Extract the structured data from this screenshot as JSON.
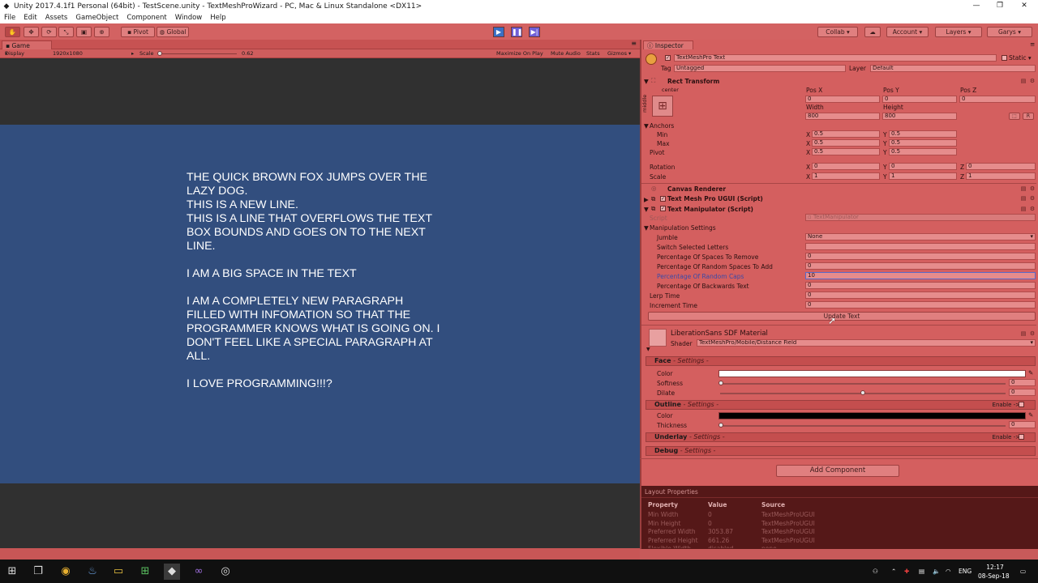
{
  "titlebar": {
    "title": "Unity 2017.4.1f1 Personal (64bit) - TestScene.unity - TextMeshProWizard - PC, Mac & Linux Standalone <DX11>",
    "minimize": "—",
    "maximize": "❐",
    "close": "✕"
  },
  "menu": [
    "File",
    "Edit",
    "Assets",
    "GameObject",
    "Component",
    "Window",
    "Help"
  ],
  "toolbar": {
    "pivot": "Pivot",
    "global": "Global",
    "collab": "Collab ▾",
    "account": "Account ▾",
    "layers": "Layers ▾",
    "layout": "Garys ▾"
  },
  "game": {
    "tab": "Game",
    "display": "Display 1",
    "resolution": "1920x1080",
    "scale_label": "Scale",
    "scale_value": "0.62",
    "maximize_on_play": "Maximize On Play",
    "mute_audio": "Mute Audio",
    "stats": "Stats",
    "gizmos": "Gizmos ▾",
    "text": "THE QUICK BROWN FOX JUMPS OVER THE\nLAZY DOG.\nTHIS IS A NEW LINE.\nTHIS IS A LINE THAT OVERFLOWS THE TEXT\nBOX BOUNDS AND GOES ON TO THE NEXT\nLINE.\n\nI AM A BIG SPACE IN THE TEXT\n\nI AM A COMPLETELY NEW PARAGRAPH\nFILLED WITH INFOMATION SO THAT THE\nPROGRAMMER KNOWS WHAT IS GOING ON. I\nDON'T FEEL LIKE A SPECIAL PARAGRAPH AT\nALL.\n\nI LOVE PROGRAMMING!!!?"
  },
  "inspector": {
    "tab": "Inspector",
    "object_name": "TextMeshPro Text",
    "static_label": "Static",
    "tag_label": "Tag",
    "tag_value": "Untagged",
    "layer_label": "Layer",
    "layer_value": "Default",
    "rect_transform": {
      "title": "Rect Transform",
      "anchor_h": "center",
      "anchor_v": "middle",
      "posx_label": "Pos X",
      "posy_label": "Pos Y",
      "posz_label": "Pos Z",
      "posx": "0",
      "posy": "0",
      "posz": "0",
      "width_label": "Width",
      "height_label": "Height",
      "width": "800",
      "height": "800",
      "anchors_label": "Anchors",
      "min_label": "Min",
      "max_label": "Max",
      "pivot_label": "Pivot",
      "min_x": "0.5",
      "min_y": "0.5",
      "max_x": "0.5",
      "max_y": "0.5",
      "pivot_x": "0.5",
      "pivot_y": "0.5",
      "rotation_label": "Rotation",
      "scale_label": "Scale",
      "rot_x": "0",
      "rot_y": "0",
      "rot_z": "0",
      "scale_x": "1",
      "scale_y": "1",
      "scale_z": "1",
      "x": "X",
      "y": "Y",
      "z": "Z",
      "btn_blueprint": "⬚",
      "btn_raw": "R"
    },
    "canvas_renderer": "Canvas Renderer",
    "tmp_ugui": "Text Mesh Pro UGUI (Script)",
    "text_manipulator": {
      "title": "Text Manipulator (Script)",
      "script_label": "Script",
      "script_value": "TextManipulator",
      "settings_label": "Manipulation Settings",
      "jumble_label": "Jumble",
      "jumble_value": "None",
      "switch_label": "Switch Selected Letters",
      "switch_value": "",
      "spaces_remove_label": "Percentage Of Spaces To Remove",
      "spaces_remove": "0",
      "spaces_add_label": "Percentage Of Random Spaces To Add",
      "spaces_add": "0",
      "caps_label": "Percentage Of Random Caps",
      "caps": "10",
      "backwards_label": "Percentage Of Backwards Text",
      "backwards": "0",
      "lerp_label": "Lerp Time",
      "lerp": "0",
      "increment_label": "Increment Time",
      "increment": "0",
      "update_button": "Update Text"
    },
    "material": {
      "name": "LiberationSans SDF Material",
      "shader_label": "Shader",
      "shader_value": "TextMeshPro/Mobile/Distance Field",
      "face": "Face",
      "outline": "Outline",
      "underlay": "Underlay",
      "debug": "Debug",
      "settings": "- Settings -",
      "enable": "Enable ->",
      "color_label": "Color",
      "softness_label": "Softness",
      "softness": "0",
      "dilate_label": "Dilate",
      "dilate": "0",
      "thickness_label": "Thickness",
      "thickness": "0",
      "face_color": "#ffffff",
      "outline_color": "#000000"
    },
    "add_component": "Add Component"
  },
  "layout_properties": {
    "title": "Layout Properties",
    "headers": [
      "Property",
      "Value",
      "Source"
    ],
    "rows": [
      [
        "Min Width",
        "0",
        "TextMeshProUGUI"
      ],
      [
        "Min Height",
        "0",
        "TextMeshProUGUI"
      ],
      [
        "Preferred Width",
        "3053.87",
        "TextMeshProUGUI"
      ],
      [
        "Preferred Height",
        "661.26",
        "TextMeshProUGUI"
      ],
      [
        "Flexible Width",
        "disabled",
        "none"
      ]
    ]
  },
  "taskbar": {
    "language": "ENG",
    "time": "12:17",
    "date": "08-Sep-18"
  },
  "colors": {
    "accent": "#d45f5f",
    "canvas_blue": "#324e7e",
    "game_bg": "#303030"
  }
}
